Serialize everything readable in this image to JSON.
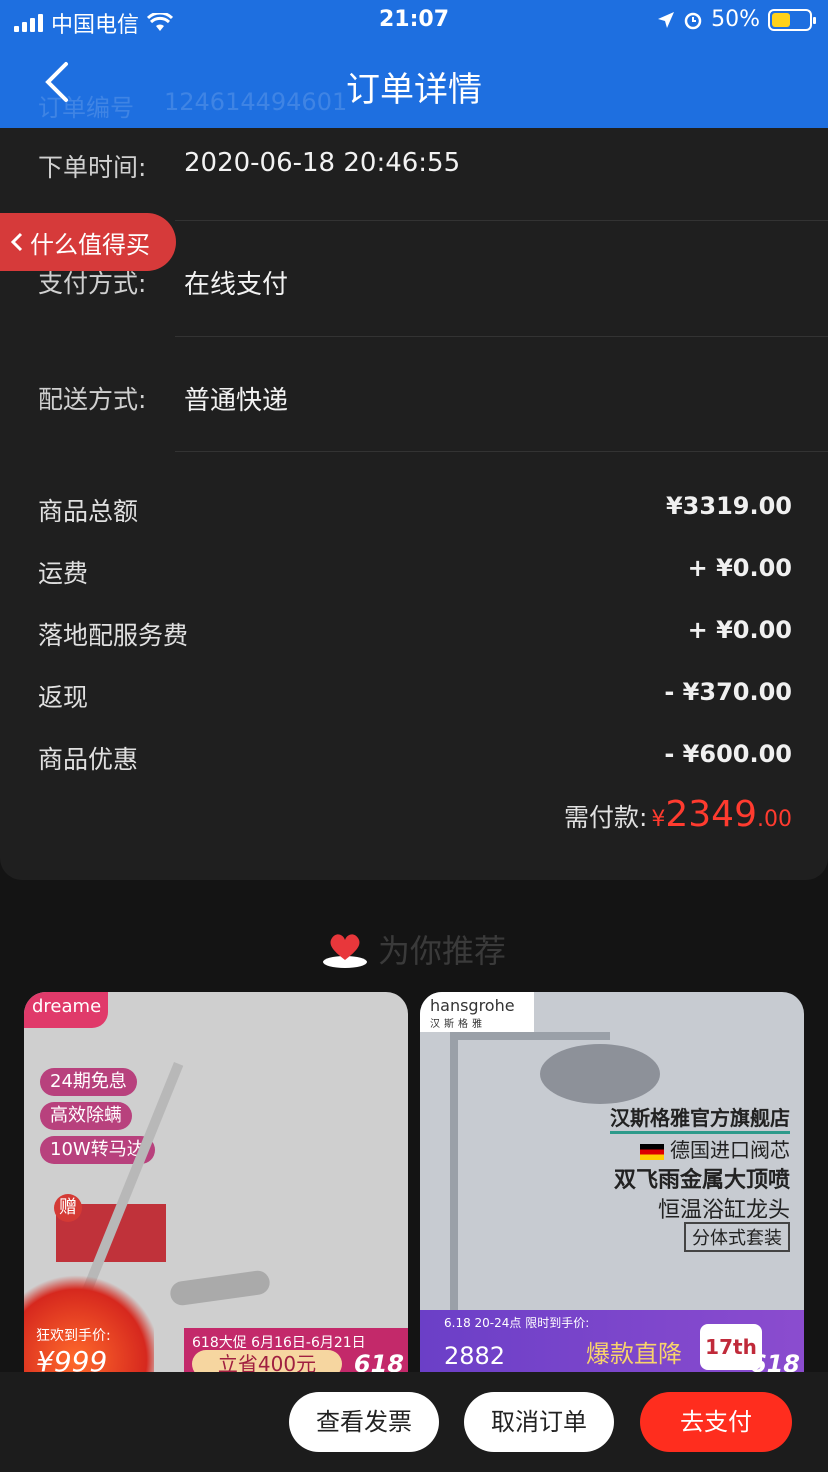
{
  "status_bar": {
    "carrier": "中国电信",
    "time": "21:07",
    "battery": "50%"
  },
  "nav": {
    "title": "订单详情",
    "ghost_label": "订单编号",
    "ghost_value": "124614494601"
  },
  "side_tag": {
    "label": "什么值得买"
  },
  "order_info": [
    {
      "label": "下单时间:",
      "value": "2020-06-18 20:46:55"
    },
    {
      "label": "支付方式:",
      "value": "在线支付"
    },
    {
      "label": "配送方式:",
      "value": "普通快递"
    }
  ],
  "price_rows": [
    {
      "label": "商品总额",
      "value": "¥3319.00"
    },
    {
      "label": "运费",
      "value": "+ ¥0.00"
    },
    {
      "label": "落地配服务费",
      "value": "+ ¥0.00"
    },
    {
      "label": "返现",
      "value": "- ¥370.00"
    },
    {
      "label": "商品优惠",
      "value": "- ¥600.00"
    }
  ],
  "total": {
    "label": "需付款:",
    "currency": "¥",
    "integer": "2349",
    "decimal": ".00"
  },
  "recommend": {
    "title": "为你推荐"
  },
  "product1": {
    "brand": "dreame",
    "pills": [
      "24期免息",
      "高效除螨",
      "10W转马达"
    ],
    "gift": "赠",
    "promo_line": "618大促 6月16日-6月21日",
    "promo_button": "立省400元",
    "price_label": "狂欢到手价:",
    "price": "¥999",
    "tag": "618"
  },
  "product2": {
    "brand_en": "hansgrohe",
    "brand_cn": "汉斯格雅",
    "shop": "汉斯格雅官方旗舰店",
    "feature1": "德国进口阀芯",
    "feature2": "双飞雨金属大顶喷",
    "feature3": "恒温浴缸龙头",
    "feature4": "分体式套装",
    "promo_line": "6.18 20-24点 限时到手价:",
    "price": "2882",
    "big": "爆款直降",
    "badge": "17th",
    "tag": "618"
  },
  "actions": {
    "invoice": "查看发票",
    "cancel": "取消订单",
    "pay": "去支付"
  },
  "colors": {
    "nav_blue": "#1e6fe0",
    "price_red": "#ff3b2f",
    "pay_button": "#ff2d1e",
    "side_tag": "#d63a3a"
  }
}
